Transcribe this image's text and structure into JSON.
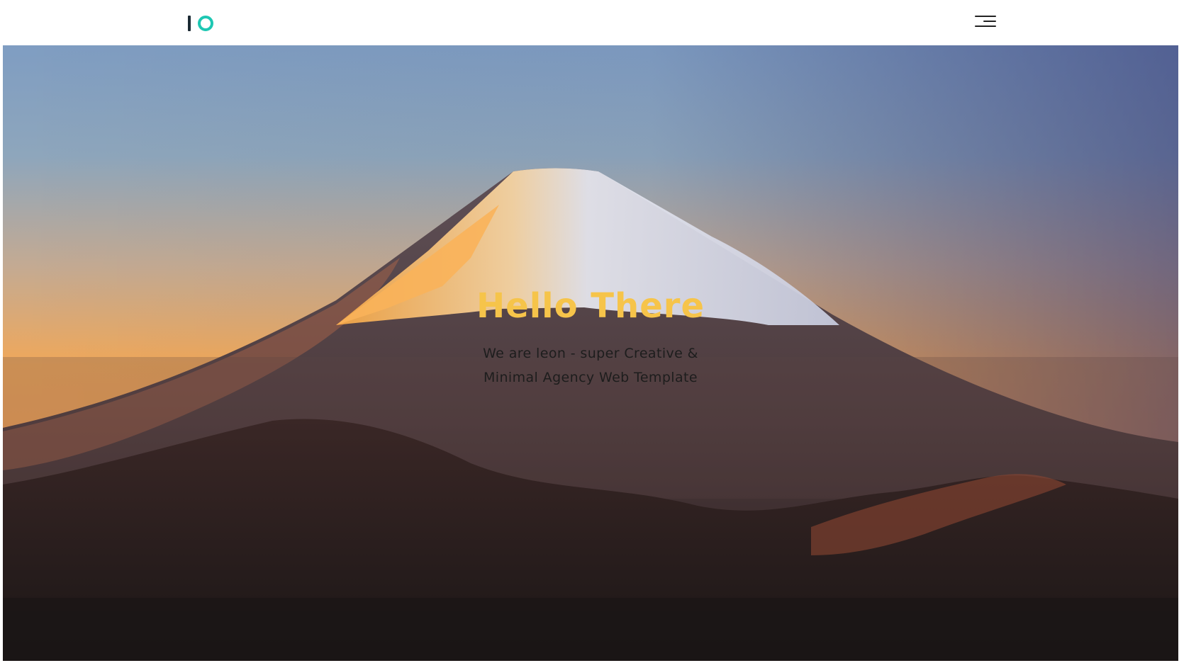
{
  "header": {
    "logo_icon": "io-logo-mark",
    "logo_colors": {
      "bar": "#1c2a33",
      "ring": "#1ec7b3"
    },
    "menu_icon": "hamburger-menu-icon"
  },
  "hero": {
    "background": "mount-fuji-sunset-photo",
    "title": "Hello There",
    "subtitle_line1": "We are leon - super Creative &",
    "subtitle_line2": "Minimal Agency Web Template",
    "title_color": "#f6c44a"
  }
}
